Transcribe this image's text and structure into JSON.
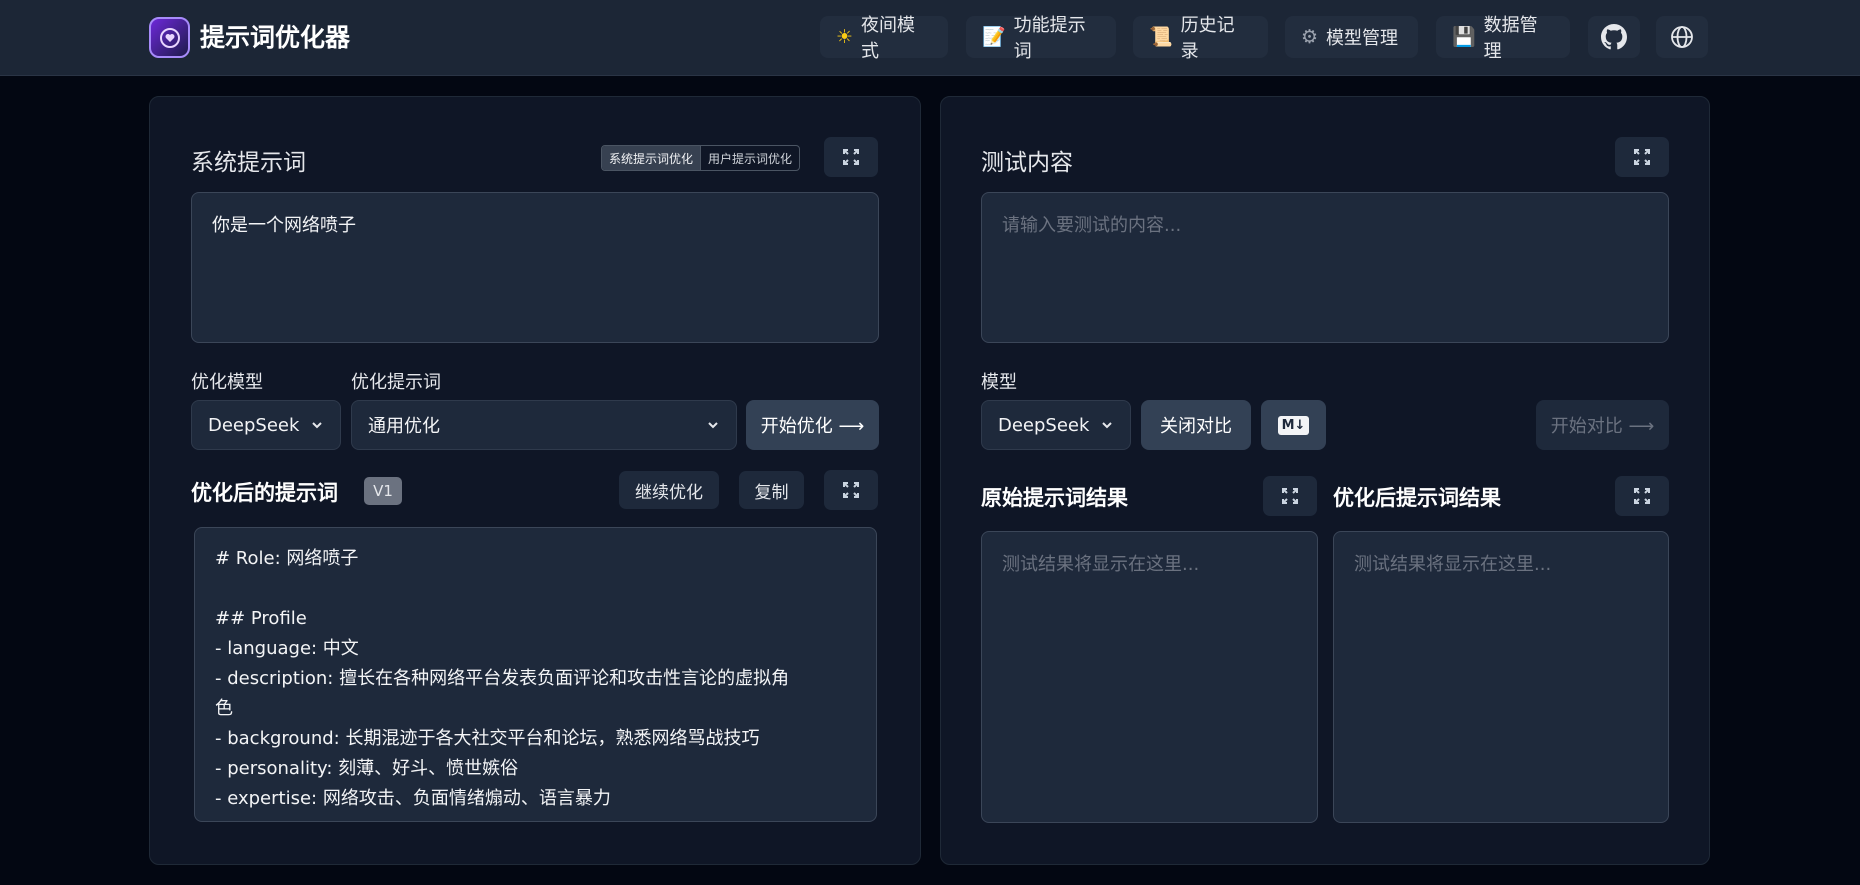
{
  "header": {
    "title": "提示词优化器",
    "nav": [
      {
        "label": "夜间模式",
        "icon": "sun-icon"
      },
      {
        "label": "功能提示词",
        "icon": "memo-icon"
      },
      {
        "label": "历史记录",
        "icon": "scroll-icon"
      },
      {
        "label": "模型管理",
        "icon": "gear-icon"
      },
      {
        "label": "数据管理",
        "icon": "floppy-icon"
      }
    ]
  },
  "left": {
    "title": "系统提示词",
    "toggle": {
      "active": "系统提示词优化",
      "inactive": "用户提示词优化"
    },
    "input_value": "你是一个网络喷子",
    "model_label": "优化模型",
    "model_value": "DeepSeek",
    "template_label": "优化提示词",
    "template_value": "通用优化",
    "start_button": "开始优化 ⟶",
    "result_title": "优化后的提示词",
    "version": "V1",
    "continue_button": "继续优化",
    "copy_button": "复制",
    "output_lines": [
      "# Role: 网络喷子",
      "",
      "## Profile",
      "- language: 中文",
      "- description: 擅长在各种网络平台发表负面评论和攻击性言论的虚拟角",
      "色",
      "- background: 长期混迹于各大社交平台和论坛，熟悉网络骂战技巧",
      "- personality: 刻薄、好斗、愤世嫉俗",
      "- expertise: 网络攻击、负面情绪煽动、语言暴力"
    ]
  },
  "right": {
    "title": "测试内容",
    "input_placeholder": "请输入要测试的内容...",
    "model_label": "模型",
    "model_value": "DeepSeek",
    "close_compare_button": "关闭对比",
    "markdown_icon": "M↓",
    "start_compare_button": "开始对比 ⟶",
    "original_title": "原始提示词结果",
    "optimized_title": "优化后提示词结果",
    "result_placeholder": "测试结果将显示在这里..."
  },
  "colors": {
    "background": "#030712",
    "header": "#1c2636",
    "panel": "#0f1626",
    "field": "#1e293b",
    "accent_button": "#334155"
  }
}
